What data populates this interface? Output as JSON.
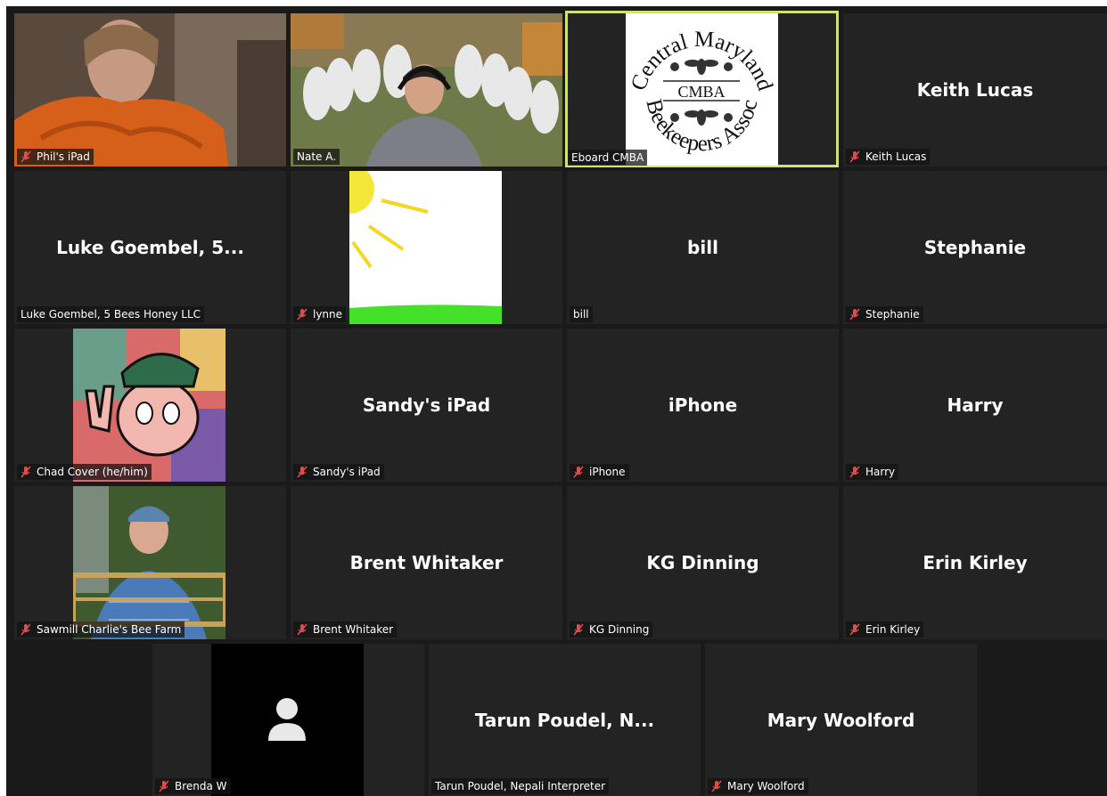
{
  "participants": {
    "phil": {
      "label": "Phil's iPad"
    },
    "nate": {
      "label": "Nate A."
    },
    "eboard": {
      "label": "Eboard CMBA"
    },
    "keith": {
      "name": "Keith Lucas",
      "label": "Keith Lucas"
    },
    "luke": {
      "name": "Luke Goembel, 5...",
      "label": "Luke Goembel, 5 Bees Honey LLC"
    },
    "lynne": {
      "label": "lynne"
    },
    "bill": {
      "name": "bill",
      "label": "bill"
    },
    "stephanie": {
      "name": "Stephanie",
      "label": "Stephanie"
    },
    "chad": {
      "label": "Chad Cover (he/him)"
    },
    "sandy": {
      "name": "Sandy's iPad",
      "label": "Sandy's iPad"
    },
    "iphone": {
      "name": "iPhone",
      "label": "iPhone"
    },
    "harry": {
      "name": "Harry",
      "label": "Harry"
    },
    "sawmill": {
      "label": "Sawmill Charlie's Bee Farm"
    },
    "brent": {
      "name": "Brent Whitaker",
      "label": "Brent Whitaker"
    },
    "kg": {
      "name": "KG Dinning",
      "label": "KG Dinning"
    },
    "erin": {
      "name": "Erin Kirley",
      "label": "Erin Kirley"
    },
    "brenda": {
      "label": "Brenda W"
    },
    "tarun": {
      "name": "Tarun Poudel, N...",
      "label": "Tarun Poudel, Nepali Interpreter"
    },
    "mary": {
      "name": "Mary Woolford",
      "label": "Mary Woolford"
    }
  },
  "logo": {
    "arc_top": "Central Maryland",
    "arc_bottom": "Beekeepers Assoc",
    "center": "CMBA"
  },
  "colors": {
    "active_speaker": "#cfe27a",
    "muted_mic": "#e04b4b",
    "tile_bg": "#232323"
  },
  "icons": {
    "muted": "mic-muted-icon",
    "avatar": "user-avatar-icon"
  }
}
